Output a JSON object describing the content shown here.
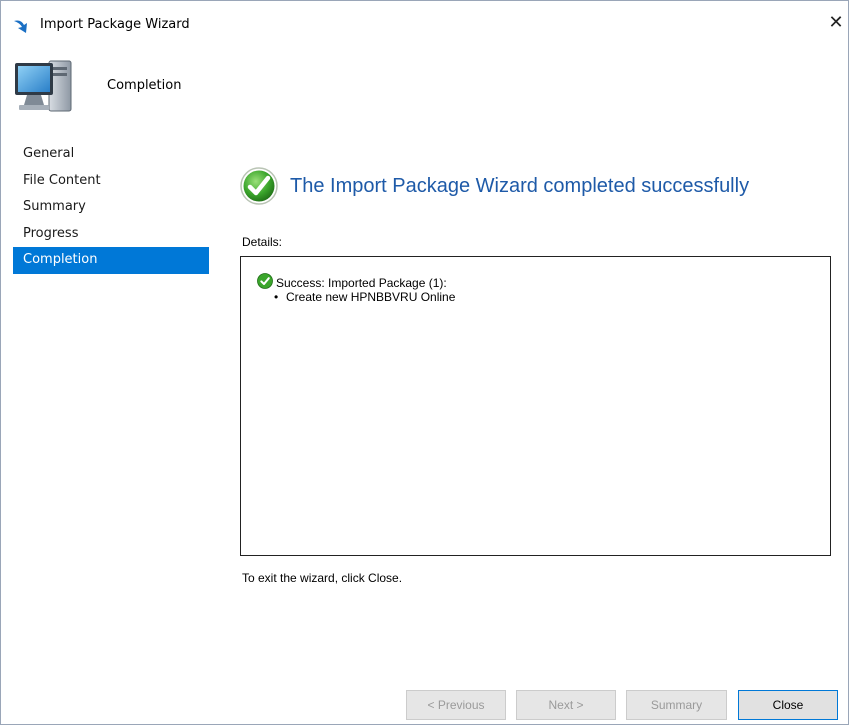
{
  "window": {
    "title": "Import Package Wizard",
    "close_symbol": "✕",
    "icon": "import-arrow-icon"
  },
  "header": {
    "title": "Completion",
    "icon": "computer-icon"
  },
  "sidebar": {
    "items": [
      {
        "label": "General",
        "active": false
      },
      {
        "label": "File Content",
        "active": false
      },
      {
        "label": "Summary",
        "active": false
      },
      {
        "label": "Progress",
        "active": false
      },
      {
        "label": "Completion",
        "active": true
      }
    ],
    "active_color": "#0078d7"
  },
  "main": {
    "heading": "The Import Package Wizard completed successfully",
    "heading_color": "#1e5aa8",
    "status_icon": "success-check-icon",
    "details_label": "Details:",
    "details": {
      "line1": "Success: Imported Package (1):",
      "bullet": "•",
      "line2": "Create new HPNBBVRU Online"
    },
    "exit_hint": "To exit the wizard, click Close."
  },
  "buttons": {
    "previous": {
      "label": "< Previous",
      "enabled": false
    },
    "next": {
      "label": "Next >",
      "enabled": false
    },
    "summary": {
      "label": "Summary",
      "enabled": false
    },
    "close": {
      "label": "Close",
      "enabled": true
    }
  }
}
